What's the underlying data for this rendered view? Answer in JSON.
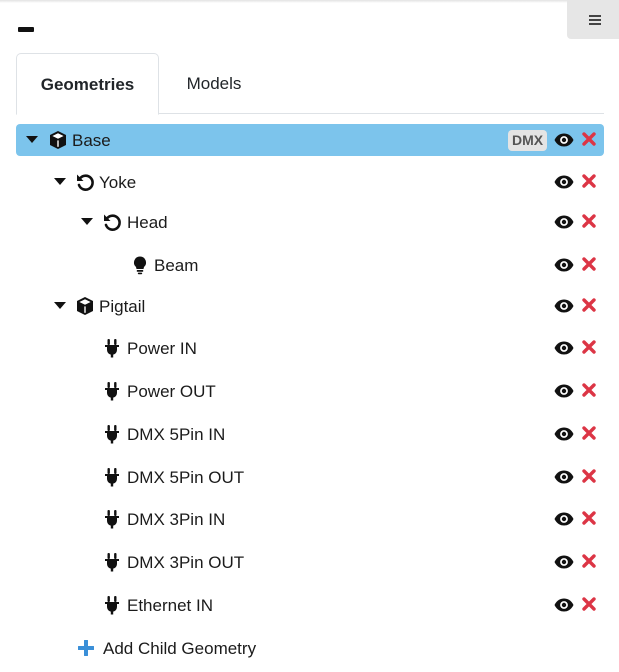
{
  "tabs": [
    {
      "label": "Geometries",
      "active": true
    },
    {
      "label": "Models",
      "active": false
    }
  ],
  "tree": {
    "base": {
      "label": "Base",
      "badge": "DMX",
      "icon": "cube-icon"
    },
    "yoke": {
      "label": "Yoke",
      "icon": "undo-icon"
    },
    "head": {
      "label": "Head",
      "icon": "undo-icon"
    },
    "beam": {
      "label": "Beam",
      "icon": "lightbulb-icon"
    },
    "pigtail": {
      "label": "Pigtail",
      "icon": "cube-icon"
    },
    "power_in": {
      "label": "Power IN",
      "icon": "plug-icon"
    },
    "power_out": {
      "label": "Power OUT",
      "icon": "plug-icon"
    },
    "dmx5_in": {
      "label": "DMX 5Pin IN",
      "icon": "plug-icon"
    },
    "dmx5_out": {
      "label": "DMX 5Pin OUT",
      "icon": "plug-icon"
    },
    "dmx3_in": {
      "label": "DMX 3Pin IN",
      "icon": "plug-icon"
    },
    "dmx3_out": {
      "label": "DMX 3Pin OUT",
      "icon": "plug-icon"
    },
    "ethernet_in": {
      "label": "Ethernet IN",
      "icon": "plug-icon"
    }
  },
  "add_child": {
    "label": "Add Child Geometry",
    "icon": "plus-icon"
  },
  "colors": {
    "selected_row": "#7cc4ec",
    "delete": "#dc3545",
    "add": "#3a8fd8"
  }
}
